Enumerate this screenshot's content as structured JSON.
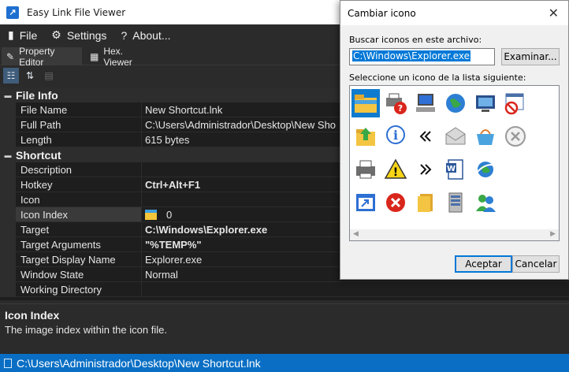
{
  "app": {
    "title": "Easy Link File Viewer"
  },
  "menu": {
    "file": "File",
    "settings": "Settings",
    "about": "About..."
  },
  "tabs": {
    "property_editor": "Property Editor",
    "hex_viewer": "Hex. Viewer"
  },
  "grid": {
    "file_info": {
      "category": "File Info",
      "file_name": {
        "name": "File Name",
        "value": "New Shortcut.lnk"
      },
      "full_path": {
        "name": "Full Path",
        "value": "C:\\Users\\Administrador\\Desktop\\New Sho"
      },
      "length": {
        "name": "Length",
        "value": "615 bytes"
      }
    },
    "shortcut": {
      "category": "Shortcut",
      "description": {
        "name": "Description",
        "value": ""
      },
      "hotkey": {
        "name": "Hotkey",
        "value": "Ctrl+Alt+F1"
      },
      "icon": {
        "name": "Icon",
        "value": ""
      },
      "icon_index": {
        "name": "Icon Index",
        "value": "0"
      },
      "target": {
        "name": "Target",
        "value": "C:\\Windows\\Explorer.exe"
      },
      "target_arguments": {
        "name": "Target Arguments",
        "value": "\"%TEMP%\""
      },
      "target_display_name": {
        "name": "Target Display Name",
        "value": "Explorer.exe"
      },
      "window_state": {
        "name": "Window State",
        "value": "Normal"
      },
      "working_directory": {
        "name": "Working Directory",
        "value": ""
      }
    }
  },
  "help": {
    "title": "Icon Index",
    "description": "The image index within the icon file."
  },
  "status": {
    "path": "C:\\Users\\Administrador\\Desktop\\New Shortcut.lnk"
  },
  "dialog": {
    "title": "Cambiar icono",
    "search_label": "Buscar iconos en este archivo:",
    "path_value": "C:\\Windows\\Explorer.exe",
    "browse_button": "Examinar...",
    "list_label": "Seleccione un icono de la lista siguiente:",
    "ok_button": "Aceptar",
    "cancel_button": "Cancelar",
    "icons": [
      "folder-icon",
      "printer-error-icon",
      "computer-icon",
      "globe-icon",
      "monitor-icon",
      "window-blocked-icon",
      "folder-up-icon",
      "info-icon",
      "rewind-icon",
      "envelope-icon",
      "basket-icon",
      "cancel-circle-icon",
      "printer-icon",
      "warning-icon",
      "fast-forward-icon",
      "document-icon",
      "globe-network-icon",
      "window-arrow-icon",
      "error-icon",
      "folders-icon",
      "server-icon",
      "users-icon"
    ],
    "selected_icon": "folder-icon"
  },
  "colors": {
    "accent": "#0a6fc4",
    "selection": "#0f7bce",
    "background": "#1e1e1e"
  }
}
